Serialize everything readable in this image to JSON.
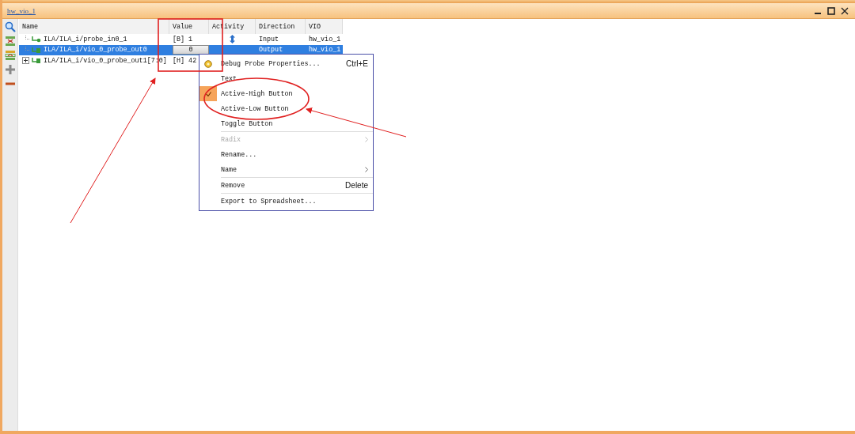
{
  "window": {
    "title": "hw_vio_1"
  },
  "table": {
    "columns": [
      "Name",
      "Value",
      "Activity",
      "Direction",
      "VIO"
    ],
    "rows": [
      {
        "name": "ILA/ILA_i/probe_in0_1",
        "kind": "input",
        "expandable": false,
        "value": {
          "kind": "text",
          "text": "[B] 1"
        },
        "direction": "Input",
        "vio": "hw_vio_1",
        "selected": false
      },
      {
        "name": "ILA/ILA_i/vio_0_probe_out0",
        "kind": "output",
        "expandable": false,
        "value": {
          "kind": "button",
          "text": "0"
        },
        "direction": "Output",
        "vio": "hw_vio_1",
        "selected": true
      },
      {
        "name": "ILA/ILA_i/vio_0_probe_out1[7:0]",
        "kind": "output",
        "expandable": true,
        "value": {
          "kind": "text",
          "text": "[H] 42"
        },
        "selected": false
      }
    ]
  },
  "context_menu": {
    "items": [
      {
        "kind": "item",
        "label": "Debug Probe Properties...",
        "shortcut": "Ctrl+E",
        "icon": true
      },
      {
        "kind": "item",
        "label": "Text",
        "checked": false
      },
      {
        "kind": "item",
        "label": "Active-High Button",
        "checked": true
      },
      {
        "kind": "item",
        "label": "Active-Low Button",
        "checked": false
      },
      {
        "kind": "item",
        "label": "Toggle Button",
        "checked": false
      },
      {
        "kind": "separator"
      },
      {
        "kind": "item",
        "label": "Radix",
        "disabled": true,
        "submenu": true
      },
      {
        "kind": "item",
        "label": "Rename..."
      },
      {
        "kind": "item",
        "label": "Name",
        "submenu": true
      },
      {
        "kind": "separator"
      },
      {
        "kind": "item",
        "label": "Remove",
        "shortcut": "Delete"
      },
      {
        "kind": "separator"
      },
      {
        "kind": "item",
        "label": "Export to Spreadsheet..."
      }
    ]
  }
}
